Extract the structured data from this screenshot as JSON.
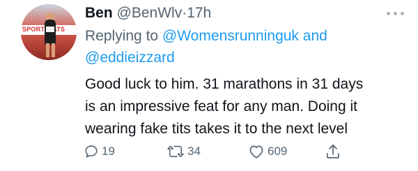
{
  "tweet": {
    "author_name": "Ben",
    "handle": "@BenWlv",
    "separator": "·",
    "time": "17h",
    "avatar_banner_text": "SPORTSTATS",
    "replying_prefix": "Replying to ",
    "reply_to_1": "@Womensrunninguk",
    "reply_and": " and",
    "reply_to_2": "@eddieizzard",
    "body_lines": [
      "Good luck to him. 31 marathons in 31 days",
      "is an impressive feat for any man. Doing it",
      "wearing fake tits takes it to the next level"
    ],
    "replies": "19",
    "retweets": "34",
    "likes": "609"
  },
  "icons": [
    "more-icon",
    "reply-icon",
    "retweet-icon",
    "like-icon",
    "share-icon"
  ],
  "colors": {
    "text": "#0f1419",
    "secondary": "#536471",
    "link": "#1d9bf0",
    "background": "#ffffff"
  }
}
